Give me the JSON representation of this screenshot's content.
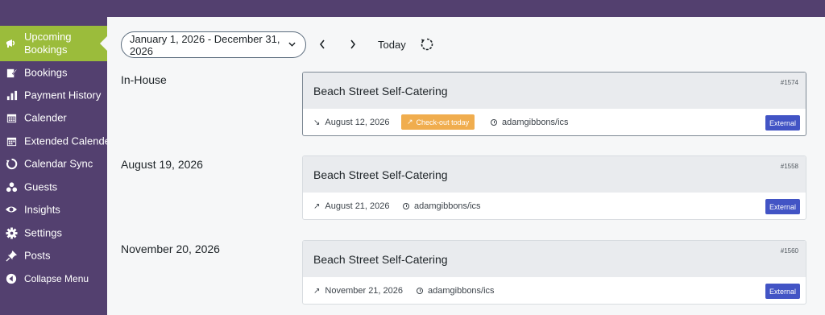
{
  "sidebar": {
    "items": [
      {
        "label": "Upcoming Bookings",
        "icon": "megaphone-icon"
      },
      {
        "label": "Bookings",
        "icon": "edit-icon"
      },
      {
        "label": "Payment History",
        "icon": "bar-chart-icon"
      },
      {
        "label": "Calender",
        "icon": "calendar-icon"
      },
      {
        "label": "Extended Calender",
        "icon": "calendar-grid-icon"
      },
      {
        "label": "Calendar Sync",
        "icon": "sync-icon"
      },
      {
        "label": "Guests",
        "icon": "users-icon"
      },
      {
        "label": "Insights",
        "icon": "eye-icon"
      },
      {
        "label": "Settings",
        "icon": "gear-icon"
      },
      {
        "label": "Posts",
        "icon": "pin-icon"
      },
      {
        "label": "Collapse Menu",
        "icon": "collapse-icon"
      }
    ]
  },
  "toolbar": {
    "date_range": "January 1, 2026 - December 31, 2026",
    "today_label": "Today"
  },
  "groups": [
    {
      "label": "In-House",
      "booking": {
        "title": "Beach Street Self-Catering",
        "id": "#1574",
        "date": "August 12, 2026",
        "badge": "Check-out today",
        "source": "adamgibbons/ics",
        "source_badge": "External"
      }
    },
    {
      "label": "August 19, 2026",
      "booking": {
        "title": "Beach Street Self-Catering",
        "id": "#1558",
        "date": "August 21, 2026",
        "source": "adamgibbons/ics",
        "source_badge": "External"
      }
    },
    {
      "label": "November 20, 2026",
      "booking": {
        "title": "Beach Street Self-Catering",
        "id": "#1560",
        "date": "November 21, 2026",
        "source": "adamgibbons/ics",
        "source_badge": "External"
      }
    }
  ],
  "colors": {
    "admin_bar": "#53406f",
    "active_item": "#9bbc3b",
    "checkout_badge": "#f0ad4e",
    "external_badge": "#4254c5"
  }
}
